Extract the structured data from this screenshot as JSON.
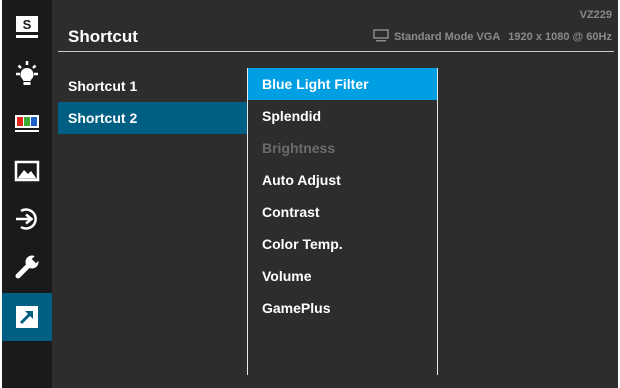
{
  "header": {
    "title": "Shortcut",
    "model": "VZ229",
    "mode": "Standard Mode VGA",
    "resolution": "1920 x 1080 @ 60Hz"
  },
  "sidebar": {
    "items": [
      {
        "icon": "splendid-s-icon"
      },
      {
        "icon": "blue-light-icon"
      },
      {
        "icon": "color-bars-icon"
      },
      {
        "icon": "image-icon"
      },
      {
        "icon": "input-select-icon"
      },
      {
        "icon": "wrench-icon"
      },
      {
        "icon": "shortcut-arrow-icon",
        "active": true
      }
    ]
  },
  "menu": {
    "items": [
      {
        "label": "Shortcut 1"
      },
      {
        "label": "Shortcut 2",
        "selected": true
      }
    ]
  },
  "submenu": {
    "items": [
      {
        "label": "Blue Light Filter",
        "selected": true
      },
      {
        "label": "Splendid"
      },
      {
        "label": "Brightness",
        "disabled": true
      },
      {
        "label": "Auto Adjust"
      },
      {
        "label": "Contrast"
      },
      {
        "label": "Color Temp."
      },
      {
        "label": "Volume"
      },
      {
        "label": "GamePlus"
      }
    ]
  },
  "colors": {
    "background": "#2d2d2d",
    "sidebar": "#1a1a1a",
    "highlight_dark": "#005f82",
    "highlight_light": "#009ee3"
  }
}
